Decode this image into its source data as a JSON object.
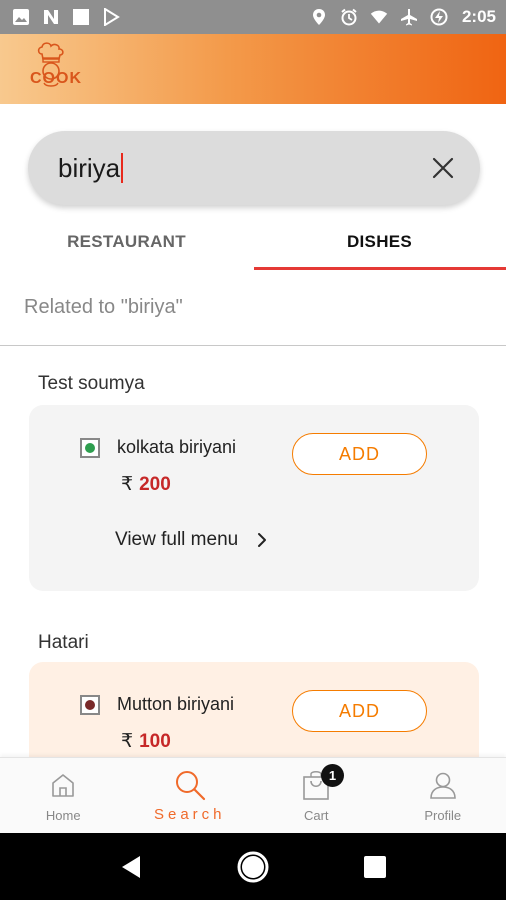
{
  "status_bar": {
    "time": "2:05"
  },
  "header": {
    "logo_text": "COOK",
    "logo_icon": "chef-logo"
  },
  "search": {
    "query": "biriya"
  },
  "tabs": [
    {
      "label": "RESTAURANT",
      "active": false
    },
    {
      "label": "DISHES",
      "active": true
    }
  ],
  "related_label": "Related to \"biriya\"",
  "restaurants": [
    {
      "name": "Test soumya",
      "dish": {
        "name": "kolkata biriyani",
        "currency": "₹",
        "price": "200",
        "type": "veg"
      },
      "add_label": "ADD",
      "view_menu_label": "View full menu"
    },
    {
      "name": "Hatari",
      "dish": {
        "name": "Mutton biriyani",
        "currency": "₹",
        "price": "100",
        "type": "non-veg"
      },
      "add_label": "ADD"
    }
  ],
  "bottom_nav": {
    "items": [
      {
        "label": "Home",
        "icon": "home-icon",
        "active": false
      },
      {
        "label": "Search",
        "icon": "search-icon",
        "active": true
      },
      {
        "label": "Cart",
        "icon": "cart-icon",
        "active": false,
        "badge": "1"
      },
      {
        "label": "Profile",
        "icon": "profile-icon",
        "active": false
      }
    ]
  },
  "colors": {
    "accent": "#f57c00",
    "tab_underline": "#e53935",
    "price": "#c62828",
    "veg": "#2e9e4f",
    "non_veg": "#7a2a2a",
    "card_gray": "#f4f4f4",
    "card_peach": "#fff0e4"
  }
}
